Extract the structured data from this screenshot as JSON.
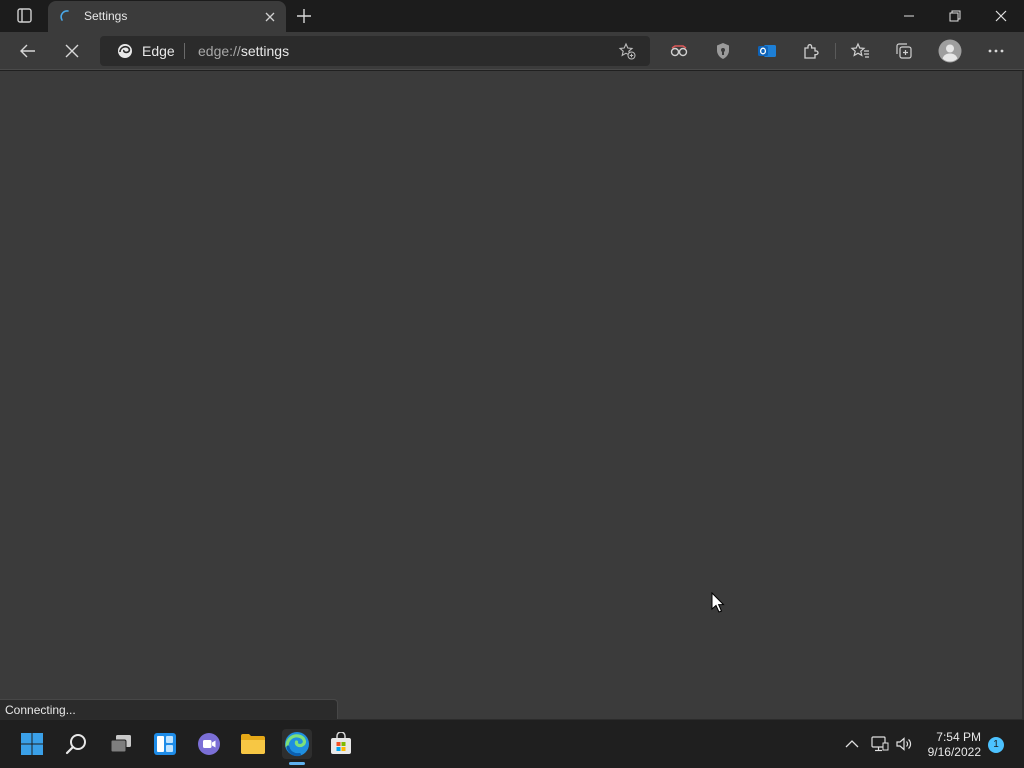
{
  "browser": {
    "tab": {
      "title": "Settings"
    },
    "address": {
      "site_label": "Edge",
      "url_prefix": "edge://",
      "url_path": "settings"
    },
    "status_text": "Connecting..."
  },
  "toolbar_icons": [
    "back-icon",
    "stop-icon",
    "add-favorite-icon",
    "tracking-icon",
    "shield-icon",
    "outlook-icon",
    "extensions-icon",
    "favorites-icon",
    "collections-icon",
    "profile-icon",
    "more-icon"
  ],
  "taskbar": {
    "apps": [
      "start",
      "search",
      "task-view",
      "widgets",
      "teams-chat",
      "file-explorer",
      "edge",
      "store"
    ],
    "clock": {
      "time": "7:54 PM",
      "date": "9/16/2022"
    },
    "notification_count": "1"
  },
  "colors": {
    "accent": "#5fb2f0",
    "content_bg": "#3b3b3b",
    "tab_bar_bg": "#1c1c1c",
    "taskbar_bg": "#1f1f1f"
  }
}
